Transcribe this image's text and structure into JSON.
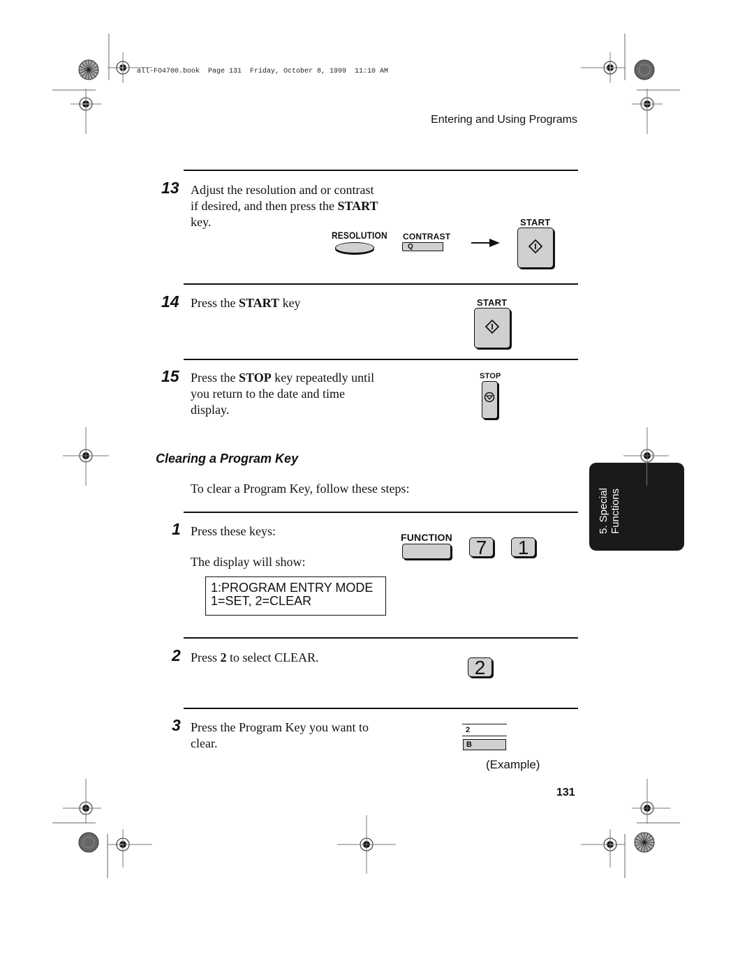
{
  "print_header": "all-FO4700.book  Page 131  Friday, October 8, 1999  11:10 AM",
  "running_header": "Entering and Using Programs",
  "steps_top": [
    {
      "number": "13",
      "lines": [
        "Adjust the resolution and or contrast",
        "if desired, and then press the ",
        "key."
      ],
      "bold": "START"
    },
    {
      "number": "14",
      "text_pre": "Press the ",
      "bold": "START",
      "text_post": " key"
    },
    {
      "number": "15",
      "text_pre": "Press the ",
      "bold": "STOP",
      "text_post": " key repeatedly until",
      "lines": [
        "you return to the date and time",
        "display."
      ]
    }
  ],
  "keys": {
    "resolution": "RESOLUTION",
    "contrast": "CONTRAST",
    "contrast_q": "Q",
    "start": "START",
    "stop": "STOP",
    "function": "FUNCTION",
    "seven": "7",
    "one": "1",
    "two": "2",
    "program_key_number": "2",
    "program_key_letter": "B"
  },
  "section": {
    "title": "Clearing a Program Key",
    "intro": "To clear a Program Key, follow these steps:"
  },
  "steps_clear": [
    {
      "number": "1",
      "text": "Press these keys:",
      "subtext": "The display will show:"
    },
    {
      "number": "2",
      "text_pre": "Press ",
      "bold": "2",
      "text_post": " to select CLEAR."
    },
    {
      "number": "3",
      "lines": [
        "Press the Program Key you want to",
        "clear."
      ]
    }
  ],
  "display": {
    "line1": "1:PROGRAM ENTRY MODE",
    "line2": "1=SET, 2=CLEAR"
  },
  "example_label": "(Example)",
  "page_number": "131",
  "side_tab": {
    "line1": "5. Special",
    "line2": "Functions"
  }
}
